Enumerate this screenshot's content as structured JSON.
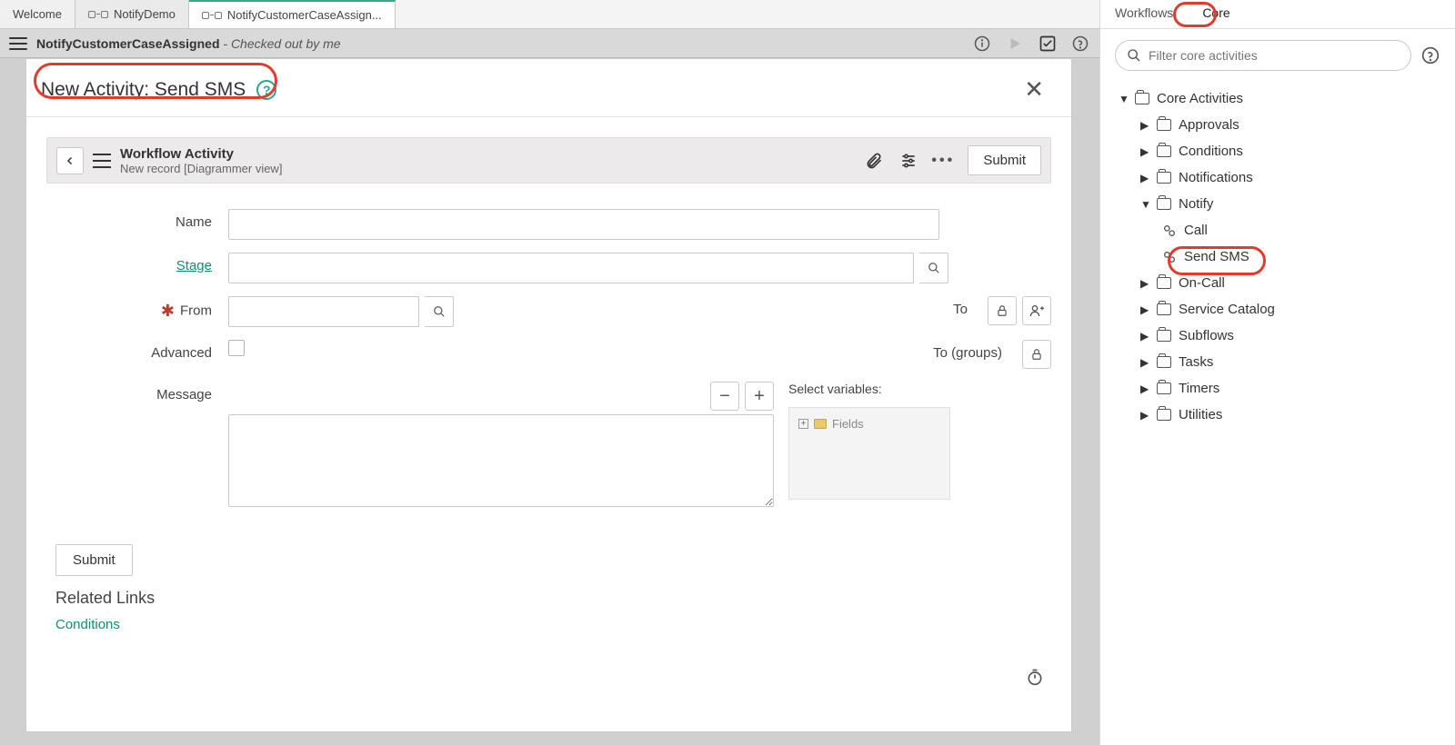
{
  "tabs": {
    "welcome": "Welcome",
    "notify_demo": "NotifyDemo",
    "notify_case": "NotifyCustomerCaseAssign..."
  },
  "breadcrumb": {
    "title": "NotifyCustomerCaseAssigned",
    "suffix": " - Checked out by me"
  },
  "modal": {
    "title": "New Activity: Send SMS",
    "form_header_title": "Workflow Activity",
    "form_header_sub": "New record [Diagrammer view]",
    "submit": "Submit",
    "labels": {
      "name": "Name",
      "stage": "Stage",
      "from": "From",
      "to": "To",
      "to_groups": "To (groups)",
      "advanced": "Advanced",
      "message": "Message",
      "select_vars": "Select variables:",
      "fields": "Fields"
    },
    "footer": {
      "submit": "Submit",
      "related_links": "Related Links",
      "conditions": "Conditions"
    }
  },
  "sidebar": {
    "tabs": {
      "workflows": "Workflows",
      "core": "Core"
    },
    "filter_placeholder": "Filter core activities",
    "root": "Core Activities",
    "items": {
      "approvals": "Approvals",
      "conditions": "Conditions",
      "notifications": "Notifications",
      "notify": "Notify",
      "call": "Call",
      "send_sms": "Send SMS",
      "on_call": "On-Call",
      "service_catalog": "Service Catalog",
      "subflows": "Subflows",
      "tasks": "Tasks",
      "timers": "Timers",
      "utilities": "Utilities"
    }
  }
}
